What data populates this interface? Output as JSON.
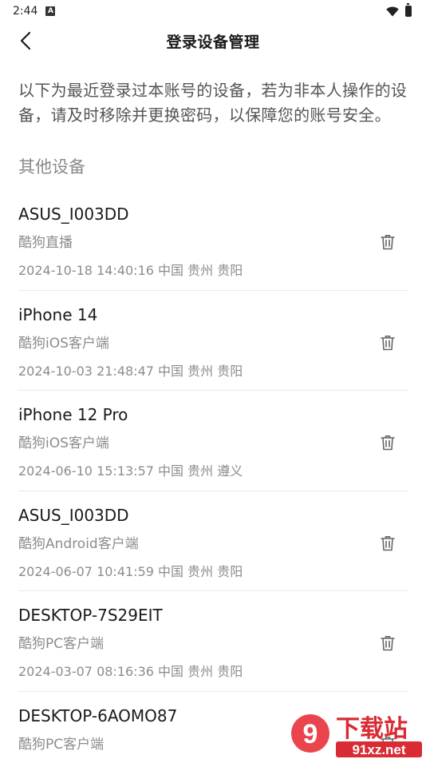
{
  "status_bar": {
    "time": "2:44"
  },
  "header": {
    "title": "登录设备管理"
  },
  "intro_text": "以下为最近登录过本账号的设备，若为非本人操作的设备，请及时移除并更换密码，以保障您的账号安全。",
  "section_title": "其他设备",
  "devices": [
    {
      "name": "ASUS_I003DD",
      "client": "酷狗直播",
      "meta": "2024-10-18 14:40:16 中国 贵州 贵阳"
    },
    {
      "name": "iPhone 14",
      "client": "酷狗iOS客户端",
      "meta": "2024-10-03 21:48:47 中国 贵州 贵阳"
    },
    {
      "name": "iPhone 12 Pro",
      "client": "酷狗iOS客户端",
      "meta": "2024-06-10 15:13:57 中国 贵州 遵义"
    },
    {
      "name": "ASUS_I003DD",
      "client": "酷狗Android客户端",
      "meta": "2024-06-07 10:41:59 中国 贵州 贵阳"
    },
    {
      "name": "DESKTOP-7S29EIT",
      "client": "酷狗PC客户端",
      "meta": "2024-03-07 08:16:36 中国 贵州 贵阳"
    },
    {
      "name": "DESKTOP-6AOMO87",
      "client": "酷狗PC客户端",
      "meta": ""
    }
  ],
  "watermark": {
    "text_big": "下载站",
    "text_small": "91xz.net",
    "logo": "9"
  },
  "icons": {
    "back": "chevron-left-icon",
    "delete": "trash-icon",
    "wifi": "wifi-icon",
    "battery": "battery-icon"
  }
}
